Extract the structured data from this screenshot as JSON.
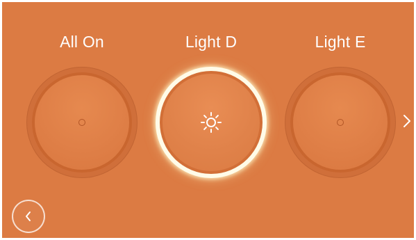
{
  "lights": [
    {
      "label": "All On",
      "state": "off",
      "icon": "dot-icon"
    },
    {
      "label": "Light D",
      "state": "on",
      "icon": "sun-icon"
    },
    {
      "label": "Light E",
      "state": "off",
      "icon": "dot-icon"
    }
  ],
  "navigation": {
    "next_icon": "chevron-right-icon",
    "back_icon": "chevron-left-icon"
  },
  "colors": {
    "background": "#dc7b43",
    "dial_off": "#c9662f",
    "dial_on_ring": "#fffbe8",
    "text": "#ffffff"
  }
}
